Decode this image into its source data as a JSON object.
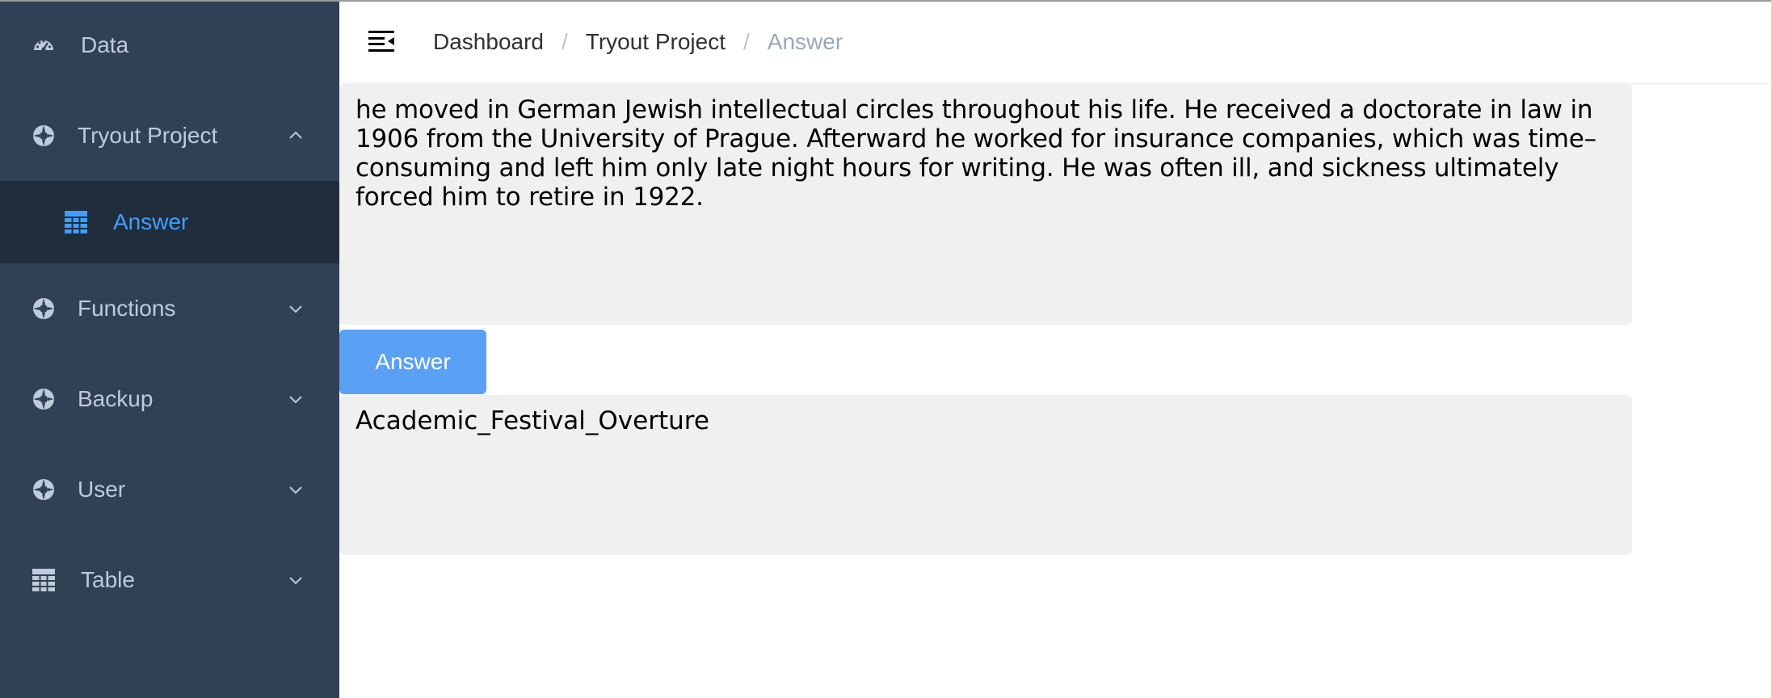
{
  "sidebar": {
    "items": [
      {
        "label": "Data",
        "icon": "dashboard-icon"
      },
      {
        "label": "Tryout Project",
        "icon": "lifebuoy-icon",
        "expanded": true,
        "children": [
          {
            "label": "Answer",
            "icon": "table-icon",
            "active": true
          }
        ]
      },
      {
        "label": "Functions",
        "icon": "lifebuoy-icon"
      },
      {
        "label": "Backup",
        "icon": "lifebuoy-icon"
      },
      {
        "label": "User",
        "icon": "lifebuoy-icon"
      },
      {
        "label": "Table",
        "icon": "table-icon"
      }
    ]
  },
  "header": {
    "breadcrumb": [
      "Dashboard",
      "Tryout Project",
      "Answer"
    ],
    "separator": "/"
  },
  "main": {
    "question_text": "he moved in German Jewish intellectual circles throughout his life. He received a doctorate in law in 1906 from the University of Prague. Afterward he worked for insurance companies, which was time–consuming and left him only late night hours for writing. He was often ill, and sickness ultimately forced him to retire in 1922.",
    "answer_button_label": "Answer",
    "answer_result": "Academic_Festival_Overture"
  },
  "colors": {
    "sidebar_bg": "#304156",
    "sidebar_active_bg": "#1f2d3d",
    "sidebar_text": "#bfcbd9",
    "accent": "#409eff",
    "button_bg": "#5aa0f5",
    "textbox_bg": "#f0f0f0"
  }
}
